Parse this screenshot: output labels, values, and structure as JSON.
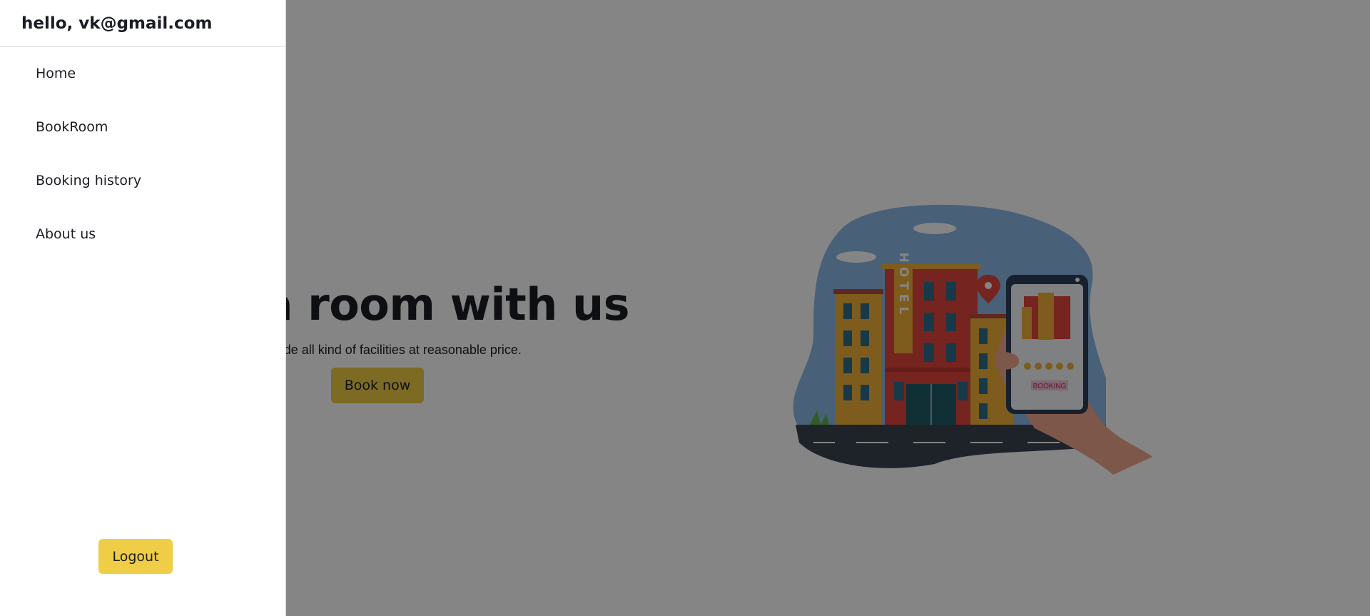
{
  "hero": {
    "title": "Book a room with us",
    "subtitle": "We provide all kind of facilities at reasonable price.",
    "book_button_label": "Book now"
  },
  "illustration": {
    "hotel_sign": "HOTEL",
    "booking_badge": "BOOKING"
  },
  "drawer": {
    "greeting": "hello, vk@gmail.com",
    "nav_items": [
      {
        "label": "Home"
      },
      {
        "label": "BookRoom"
      },
      {
        "label": "Booking history"
      },
      {
        "label": "About us"
      }
    ],
    "logout_label": "Logout"
  },
  "colors": {
    "accent": "#efcd46",
    "backdrop": "rgba(0,0,0,0.48)",
    "text": "#1a1d23"
  }
}
